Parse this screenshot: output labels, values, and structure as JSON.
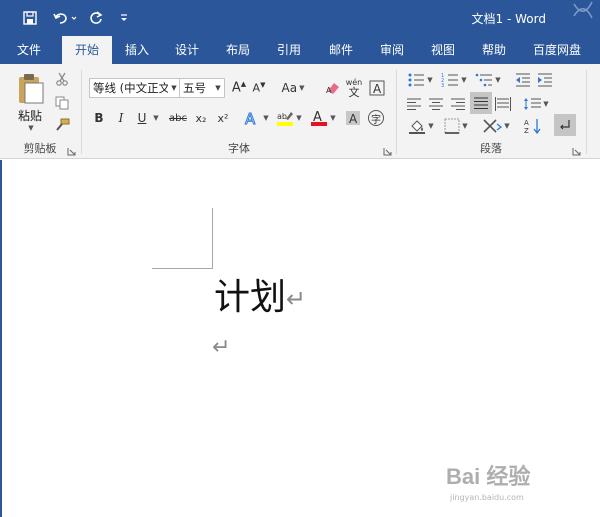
{
  "app": {
    "title": "文档1  -  Word",
    "accent_color": "#2b579a"
  },
  "quick_access": {
    "items": [
      "save-icon",
      "undo-icon",
      "redo-icon",
      "customize-icon"
    ]
  },
  "tabs": [
    {
      "label": "文件",
      "active": false
    },
    {
      "label": "开始",
      "active": true
    },
    {
      "label": "插入",
      "active": false
    },
    {
      "label": "设计",
      "active": false
    },
    {
      "label": "布局",
      "active": false
    },
    {
      "label": "引用",
      "active": false
    },
    {
      "label": "邮件",
      "active": false
    },
    {
      "label": "审阅",
      "active": false
    },
    {
      "label": "视图",
      "active": false
    },
    {
      "label": "帮助",
      "active": false
    },
    {
      "label": "百度网盘",
      "active": false
    }
  ],
  "clipboard": {
    "group_label": "剪贴板",
    "paste_label": "粘贴"
  },
  "font": {
    "group_label": "字体",
    "font_name": "等线 (中文正文)",
    "font_size": "五号",
    "case_label": "Aa",
    "bold": "B",
    "italic": "I",
    "underline": "U",
    "strikethrough": "abc",
    "subscript": "x₂",
    "superscript": "x²",
    "font_color_letter": "A",
    "highlight_color": "#ffff00",
    "font_color": "#e81123",
    "phonetic": "wén",
    "phonetic_sub": "文",
    "enclose_char": "字"
  },
  "paragraph": {
    "group_label": "段落"
  },
  "document": {
    "heading_text": "计划",
    "paragraph_mark": "↵"
  },
  "watermark": {
    "brand": "Bai 经验",
    "url": "jingyan.baidu.com"
  }
}
